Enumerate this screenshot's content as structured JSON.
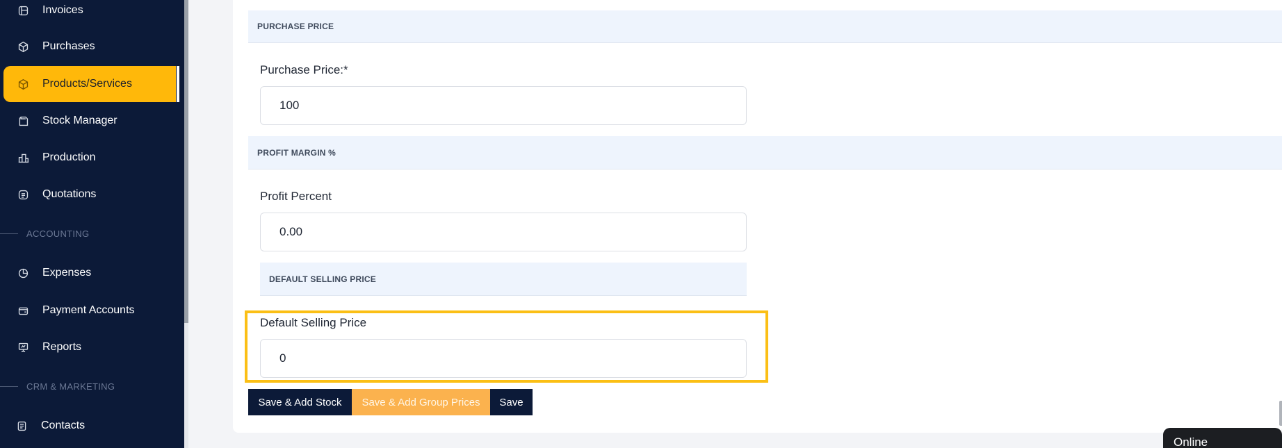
{
  "sidebar": {
    "items": [
      {
        "label": "Invoices",
        "icon": "invoice-icon"
      },
      {
        "label": "Purchases",
        "icon": "purchase-box-icon"
      },
      {
        "label": "Products/Services",
        "icon": "product-box-icon",
        "active": true
      },
      {
        "label": "Stock Manager",
        "icon": "clipboard-icon"
      },
      {
        "label": "Production",
        "icon": "factory-icon"
      },
      {
        "label": "Quotations",
        "icon": "quotation-icon"
      },
      {
        "label": "Expenses",
        "icon": "pie-chart-icon"
      },
      {
        "label": "Payment Accounts",
        "icon": "wallet-icon"
      },
      {
        "label": "Reports",
        "icon": "presentation-icon"
      },
      {
        "label": "Contacts",
        "icon": "contacts-icon"
      }
    ],
    "sections": {
      "accounting": "ACCOUNTING",
      "crm": "CRM & MARKETING"
    }
  },
  "form": {
    "purchase_price": {
      "header": "PURCHASE PRICE",
      "label": "Purchase Price:*",
      "value": "100"
    },
    "profit_margin": {
      "header": "PROFIT MARGIN %",
      "label": "Profit Percent",
      "value": "0.00"
    },
    "default_selling": {
      "header": "DEFAULT SELLING PRICE",
      "label": "Default Selling Price",
      "value": "0"
    }
  },
  "buttons": {
    "save_add_stock": "Save & Add Stock",
    "save_group_prices": "Save & Add Group Prices",
    "save": "Save"
  },
  "chat": {
    "status": "Online"
  },
  "colors": {
    "sidebar_bg": "#0c1a38",
    "accent": "#ffb80a",
    "highlight": "#fbbf15",
    "button_dark": "#0c1a38",
    "button_orange": "#fbb24e"
  }
}
